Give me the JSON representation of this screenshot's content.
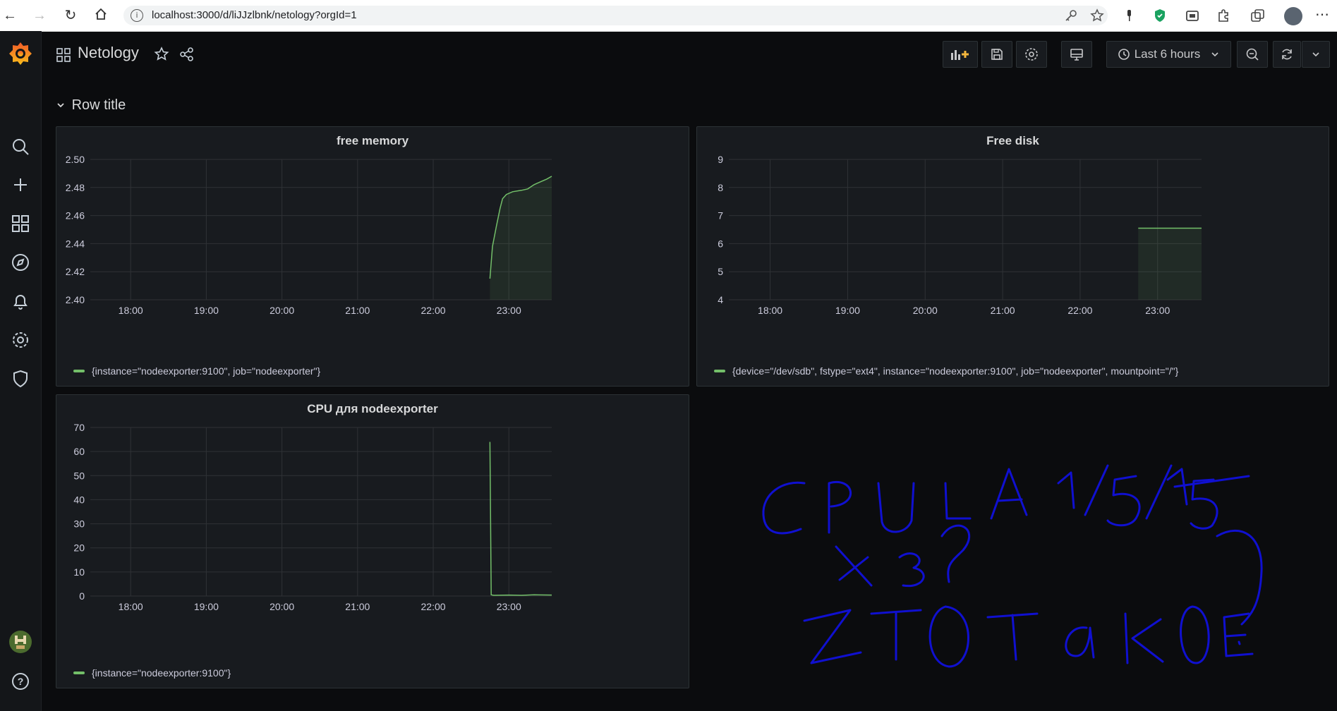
{
  "browser": {
    "url": "localhost:3000/d/liJJzlbnk/netology?orgId=1"
  },
  "header": {
    "title": "Netology",
    "time_range": "Last 6 hours"
  },
  "row": {
    "title": "Row title"
  },
  "panels": {
    "free_memory": {
      "title": "free memory",
      "legend": "{instance=\"nodeexporter:9100\", job=\"nodeexporter\"}"
    },
    "free_disk": {
      "title": "Free disk",
      "legend": "{device=\"/dev/sdb\", fstype=\"ext4\", instance=\"nodeexporter:9100\", job=\"nodeexporter\", mountpoint=\"/\"}"
    },
    "cpu": {
      "title": "CPU для nodeexporter",
      "legend": "{instance=\"nodeexporter:9100\"}"
    }
  },
  "annotation": {
    "lines": [
      "CPULA 1/5/15",
      "X3?",
      "ZTO TAKOE?"
    ]
  },
  "colors": {
    "series": "#73bf69",
    "background": "#0b0c0e",
    "panel": "#181b1f",
    "annotation": "#1010d0"
  },
  "chart_data": [
    {
      "type": "area",
      "title": "free memory",
      "x_ticks": [
        "18:00",
        "19:00",
        "20:00",
        "21:00",
        "22:00",
        "23:00"
      ],
      "y_ticks": [
        "2.40",
        "2.42",
        "2.44",
        "2.46",
        "2.48",
        "2.50"
      ],
      "ylim": [
        2.4,
        2.5
      ],
      "xlim": [
        "17:28",
        "23:34"
      ],
      "series": [
        {
          "name": "{instance=\"nodeexporter:9100\", job=\"nodeexporter\"}",
          "x": [
            "22:45",
            "22:47",
            "22:50",
            "22:53",
            "22:55",
            "22:58",
            "23:03",
            "23:10",
            "23:15",
            "23:20",
            "23:25",
            "23:30",
            "23:34"
          ],
          "y": [
            2.415,
            2.438,
            2.452,
            2.465,
            2.472,
            2.475,
            2.477,
            2.478,
            2.479,
            2.482,
            2.484,
            2.486,
            2.488
          ]
        }
      ]
    },
    {
      "type": "area",
      "title": "Free disk",
      "x_ticks": [
        "18:00",
        "19:00",
        "20:00",
        "21:00",
        "22:00",
        "23:00"
      ],
      "y_ticks": [
        "4",
        "5",
        "6",
        "7",
        "8",
        "9"
      ],
      "ylim": [
        4,
        9
      ],
      "xlim": [
        "17:28",
        "23:34"
      ],
      "series": [
        {
          "name": "{device=\"/dev/sdb\", fstype=\"ext4\", instance=\"nodeexporter:9100\", job=\"nodeexporter\", mountpoint=\"/\"}",
          "x": [
            "22:45",
            "23:34"
          ],
          "y": [
            6.55,
            6.55
          ]
        }
      ]
    },
    {
      "type": "line",
      "title": "CPU для nodeexporter",
      "x_ticks": [
        "18:00",
        "19:00",
        "20:00",
        "21:00",
        "22:00",
        "23:00"
      ],
      "y_ticks": [
        "0",
        "10",
        "20",
        "30",
        "40",
        "50",
        "60",
        "70"
      ],
      "ylim": [
        0,
        70
      ],
      "xlim": [
        "17:28",
        "23:34"
      ],
      "series": [
        {
          "name": "{instance=\"nodeexporter:9100\"}",
          "x": [
            "22:45",
            "22:46",
            "22:48",
            "23:00",
            "23:10",
            "23:20",
            "23:34"
          ],
          "y": [
            64,
            0.5,
            0.3,
            0.4,
            0.3,
            0.5,
            0.4
          ]
        }
      ]
    }
  ]
}
